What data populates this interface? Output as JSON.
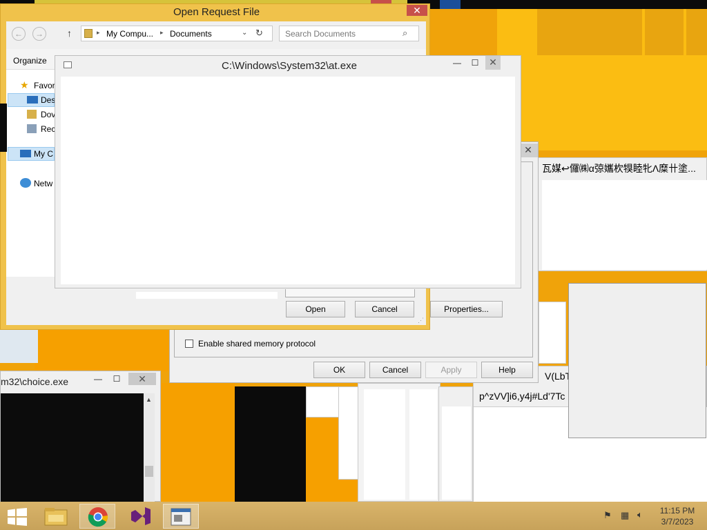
{
  "colors": {
    "accent": "#fbbd12",
    "desktop": "#f0a30a",
    "close_red": "#c7504a"
  },
  "open_request_file": {
    "title": "Open Request File",
    "breadcrumb": [
      "My Compu...",
      "Documents"
    ],
    "search_placeholder": "Search Documents",
    "organize_label": "Organize",
    "nav": [
      "Favor",
      "Des",
      "Dov",
      "Rec",
      "My C",
      "Netw"
    ],
    "open_label": "Open",
    "cancel_label": "Cancel"
  },
  "at_exe": {
    "title": "C:\\Windows\\System32\\at.exe"
  },
  "choice_exe": {
    "title": "m32\\choice.exe"
  },
  "properties_dialog": {
    "properties_label": "Properties...",
    "shared_memory_label": "Enable shared memory protocol",
    "ok_label": "OK",
    "cancel_label": "Cancel",
    "apply_label": "Apply",
    "help_label": "Help"
  },
  "garbled_window": {
    "text": "瓦媒↩儸㈱α弶孈杴犑睦牝Λ糜卄塗..."
  },
  "bottom_texts": {
    "line1": "V(LbT^",
    "line2": "p^zVV]i6,y4j#Ld'7Tc"
  },
  "taskbar": {
    "apps": [
      "start-icon",
      "file-explorer-icon",
      "chrome-icon",
      "visual-studio-icon",
      "window-app-icon"
    ],
    "time": "11:15 PM",
    "date": "3/7/2023"
  }
}
